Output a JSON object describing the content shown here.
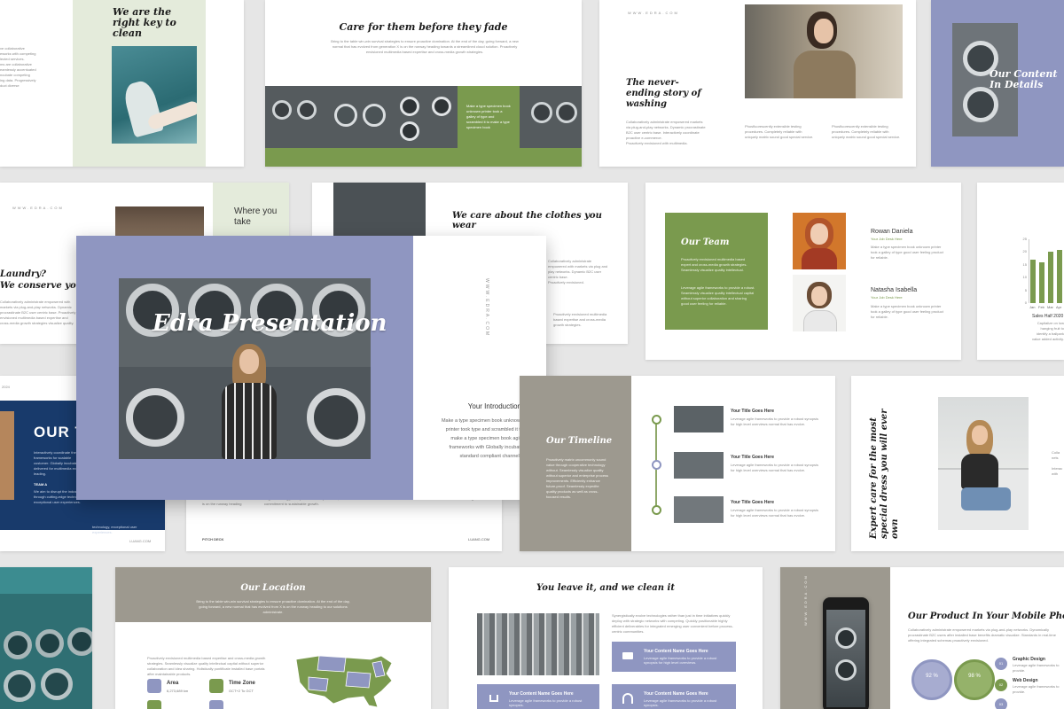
{
  "colors": {
    "green": "#7a9a4e",
    "lavender": "#8f96c1",
    "navy": "#183a6b",
    "taupe": "#9d998f",
    "mint": "#e4ebdb",
    "background": "#e6e6e6"
  },
  "slides": {
    "iron": {
      "title": "We are the right key to clean"
    },
    "care": {
      "title": "Care for them before they fade",
      "panel_text": "Make a type specimen book unknown printer took a galley of type and scrambled it to make a type specimen book"
    },
    "never_ending": {
      "header": "WWW.EDRA.COM",
      "title": "The never-ending story of washing"
    },
    "content_details": {
      "title": "Our Content In Details"
    },
    "laundry": {
      "header": "WWW.EDRA.COM",
      "title_1": "Laundry?",
      "title_2": "We conserve your en",
      "where": "Where you take"
    },
    "clothes": {
      "title": "We care about the clothes you wear"
    },
    "team": {
      "title": "Our Team",
      "member_1_name": "Rowan Daniela",
      "member_1_role": "Your Job Desk Here",
      "member_2_name": "Natasha Isabella",
      "member_2_role": "Your Job Desk Here"
    },
    "sales": {
      "title": "Sales Half 2020",
      "months": [
        "Jan",
        "Feb",
        "Mar",
        "Apr"
      ],
      "ticks": [
        "25",
        "20",
        "15",
        "10",
        "5",
        "0"
      ]
    },
    "cover": {
      "title": "Edra Presentation",
      "website": "WWW.EDRA.COM",
      "intro_title": "Your Introduction",
      "intro_text": "Make a type specimen book unknown printer took type and scrambled it to make a type specimen book agile frameworks with Globally incubate standard compliant channels."
    },
    "our_t": {
      "title": "OUR T",
      "year": "2024",
      "team_label": "TEAM A",
      "footer": "LUANG.COM"
    },
    "pitch": {
      "footer_left": "PITCH DECK",
      "footer_right": "LUANG.COM"
    },
    "timeline": {
      "title": "Our Timeline",
      "items": [
        "Your Title Goes Here",
        "Your Title Goes Here",
        "Your Title Goes Here"
      ]
    },
    "expert": {
      "title": "Expert care for the most special dress you will ever own"
    },
    "location": {
      "title": "Our Location",
      "area_label": "Area",
      "area_value": "6,273,689 km",
      "timezone_label": "Time Zone",
      "timezone_value": "GCT+2 To GCT"
    },
    "leave_it": {
      "title": "You leave it, and we clean it",
      "box_title": "Your Content Name Goes Here"
    },
    "mobile": {
      "title": "Our Product In Your Mobile Phone",
      "website": "WWW.EDRA.COM",
      "stat_1": "92 %",
      "stat_2": "98 %",
      "item_1_num": "01",
      "item_1_label": "Graphic Design",
      "item_2_num": "02",
      "item_2_label": "Web Design",
      "item_3_num": "03"
    }
  },
  "chart_data": {
    "type": "bar",
    "categories": [
      "Jan",
      "Feb",
      "Mar",
      "Apr"
    ],
    "values": [
      17,
      16,
      20,
      21
    ],
    "title": "Sales Half 2020",
    "ylim": [
      0,
      25
    ]
  }
}
